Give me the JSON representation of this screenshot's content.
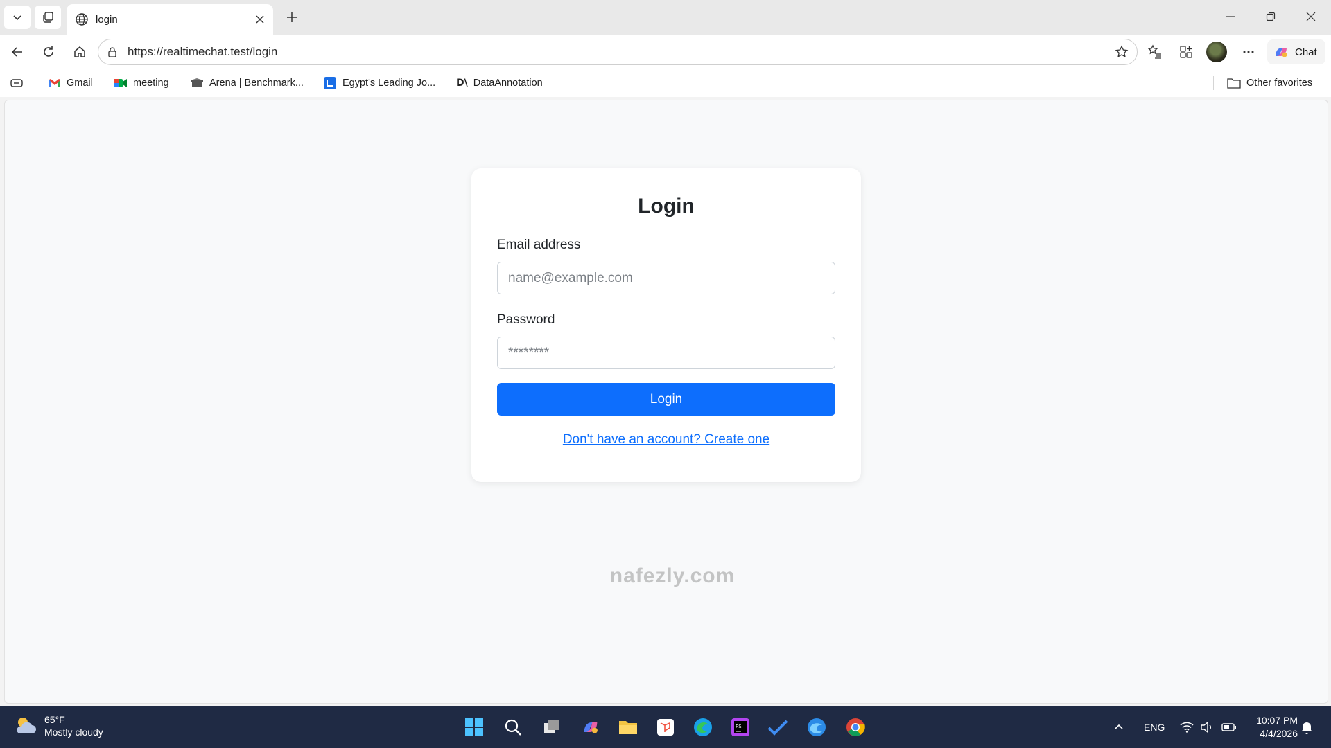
{
  "browser": {
    "tab_title": "login",
    "url": "https://realtimechat.test/login",
    "chat_label": "Chat"
  },
  "favorites": [
    {
      "label": "Gmail",
      "icon": "gmail-icon"
    },
    {
      "label": "meeting",
      "icon": "meet-icon"
    },
    {
      "label": "Arena | Benchmark...",
      "icon": "arena-icon"
    },
    {
      "label": "Egypt's Leading Jo...",
      "icon": "jobs-icon"
    },
    {
      "label": "DataAnnotation",
      "icon": "dataannotation-icon"
    }
  ],
  "other_favorites": "Other favorites",
  "login": {
    "title": "Login",
    "email_label": "Email address",
    "email_placeholder": "name@example.com",
    "password_label": "Password",
    "password_placeholder": "********",
    "submit_label": "Login",
    "register_link": "Don't have an account? Create one"
  },
  "taskbar": {
    "temperature": "65°F",
    "weather": "Mostly cloudy",
    "language": "ENG",
    "time": "10:07 PM",
    "date": "4/4/2026"
  },
  "colors": {
    "primary": "#0d6efd",
    "page_bg": "#f8f9fa",
    "taskbar_bg": "#1f2a44"
  }
}
